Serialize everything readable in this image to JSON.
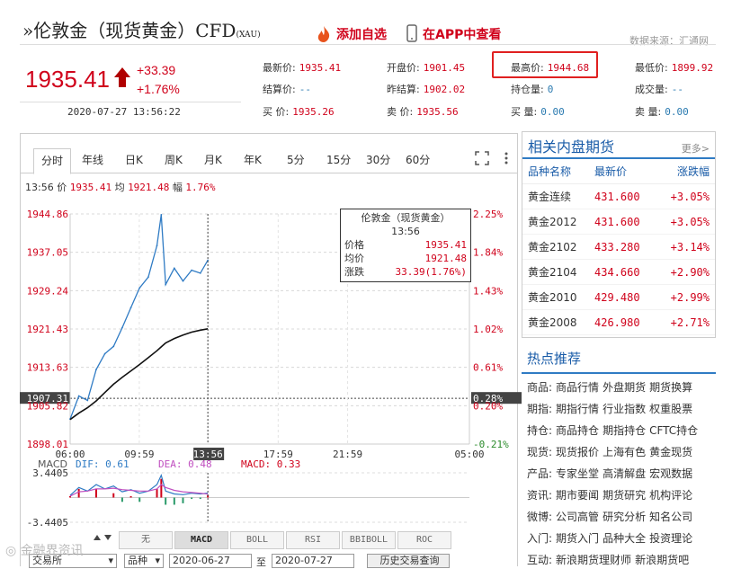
{
  "header": {
    "title": "»伦敦金（现货黄金）CFD",
    "title_sub": "(XAU)",
    "add_fav": "添加自选",
    "app_view": "在APP中查看",
    "source": "数据来源：汇通网"
  },
  "quote": {
    "price": "1935.41",
    "change": "+33.39",
    "change_pct": "+1.76%",
    "timestamp": "2020-07-27  13:56:22",
    "fields": [
      {
        "label": "最新价:",
        "value": "1935.41"
      },
      {
        "label": "开盘价:",
        "value": "1901.45"
      },
      {
        "label": "最高价:",
        "value": "1944.68"
      },
      {
        "label": "最低价:",
        "value": "1899.92"
      },
      {
        "label": "结算价:",
        "value": "--"
      },
      {
        "label": "昨结算:",
        "value": "1902.02"
      },
      {
        "label": "持仓量:",
        "value": "0"
      },
      {
        "label": "成交量:",
        "value": "--"
      },
      {
        "label": "买  价:",
        "value": "1935.26"
      },
      {
        "label": "卖  价:",
        "value": "1935.56"
      },
      {
        "label": "买  量:",
        "value": "0.00"
      },
      {
        "label": "卖  量:",
        "value": "0.00"
      }
    ]
  },
  "chart_tabs": [
    "分时",
    "年线",
    "日K",
    "周K",
    "月K",
    "年K",
    "5分",
    "15分",
    "30分",
    "60分"
  ],
  "chart_tools": {
    "fullscreen": "fullscreen-icon",
    "menu": "more-icon"
  },
  "info_line": {
    "time": "13:56",
    "price_label": "价",
    "price": "1935.41",
    "avg_label": "均",
    "avg": "1921.48",
    "amp_label": "幅",
    "amp": "1.76%"
  },
  "chart_data": {
    "type": "line",
    "y_ticks_left": [
      "1944.86",
      "1937.05",
      "1929.24",
      "1921.43",
      "1913.63",
      "1907.31",
      "1905.82",
      "1898.01"
    ],
    "y_ticks_right": [
      "2.25%",
      "1.84%",
      "1.43%",
      "1.02%",
      "0.61%",
      "0.28%",
      "0.20%",
      "-0.21%"
    ],
    "x_ticks": [
      "06:00",
      "09:59",
      "13:56",
      "17:59",
      "21:59",
      "05:00"
    ],
    "ylim": [
      1898.01,
      1944.86
    ],
    "x": [
      "06:00",
      "06:30",
      "07:00",
      "07:30",
      "08:00",
      "08:30",
      "09:00",
      "09:30",
      "10:00",
      "10:30",
      "11:00",
      "11:15",
      "11:30",
      "12:00",
      "12:30",
      "13:00",
      "13:30",
      "13:56"
    ],
    "series": [
      {
        "name": "价格",
        "values": [
          1903.1,
          1907.8,
          1906.9,
          1913.2,
          1916.4,
          1917.9,
          1921.7,
          1925.8,
          1929.8,
          1932.0,
          1938.4,
          1944.7,
          1930.5,
          1933.8,
          1931.2,
          1933.4,
          1932.8,
          1935.41
        ]
      },
      {
        "name": "均价",
        "values": [
          1903.0,
          1904.3,
          1905.4,
          1906.8,
          1908.5,
          1910.2,
          1911.6,
          1912.9,
          1914.2,
          1915.6,
          1917.0,
          1917.8,
          1918.6,
          1919.5,
          1920.2,
          1920.8,
          1921.2,
          1921.48
        ]
      }
    ],
    "tooltip": {
      "title": "伦敦金（现货黄金）",
      "time": "13:56",
      "rows": [
        {
          "label": "价格",
          "value": "1935.41"
        },
        {
          "label": "均价",
          "value": "1921.48"
        },
        {
          "label": "涨跌",
          "value": "33.39(1.76%)"
        }
      ]
    },
    "macd": {
      "dif_label": "DIF: 0.61",
      "dea_label": "DEA: 0.48",
      "macd_label": "MACD: 0.33",
      "name": "MACD",
      "y_ticks": [
        "3.4405",
        "-3.4405"
      ],
      "ylim": [
        -3.4405,
        3.4405
      ],
      "dif": [
        0.3,
        1.4,
        0.9,
        1.8,
        1.2,
        1.6,
        0.8,
        1.1,
        0.6,
        0.9,
        1.8,
        3.1,
        0.9,
        0.5,
        0.4,
        0.6,
        0.5,
        0.61
      ],
      "dea": [
        0.2,
        0.8,
        0.9,
        1.2,
        1.2,
        1.3,
        1.1,
        1.0,
        0.9,
        0.9,
        1.2,
        1.8,
        1.4,
        1.0,
        0.8,
        0.7,
        0.6,
        0.48
      ],
      "hist": [
        0.2,
        1.2,
        0.0,
        1.2,
        0.0,
        0.6,
        -0.6,
        0.2,
        -0.6,
        0.0,
        1.2,
        2.6,
        -1.0,
        -1.0,
        -0.8,
        -0.2,
        -0.2,
        0.33
      ]
    }
  },
  "indicator_tabs": [
    "无",
    "MACD",
    "BOLL",
    "RSI",
    "BBIBOLL",
    "ROC"
  ],
  "form": {
    "exchange": "交易所",
    "variety": "品种",
    "date_from": "2020-06-27",
    "to": "至",
    "date_to": "2020-07-27",
    "query_btn": "历史交易查询"
  },
  "related": {
    "title": "相关内盘期货",
    "more": "更多>",
    "columns": [
      "品种名称",
      "最新价",
      "涨跌幅"
    ],
    "rows": [
      {
        "name": "黄金连续",
        "price": "431.600",
        "pct": "+3.05%"
      },
      {
        "name": "黄金2012",
        "price": "431.600",
        "pct": "+3.05%"
      },
      {
        "name": "黄金2102",
        "price": "433.280",
        "pct": "+3.14%"
      },
      {
        "name": "黄金2104",
        "price": "434.660",
        "pct": "+2.90%"
      },
      {
        "name": "黄金2010",
        "price": "429.480",
        "pct": "+2.99%"
      },
      {
        "name": "黄金2008",
        "price": "426.980",
        "pct": "+2.71%"
      }
    ]
  },
  "hot": {
    "title": "热点推荐",
    "rows": [
      {
        "key": "商品:",
        "links": [
          "商品行情",
          "外盘期货",
          "期货换算"
        ]
      },
      {
        "key": "期指:",
        "links": [
          "期指行情",
          "行业指数",
          "权重股票"
        ]
      },
      {
        "key": "持仓:",
        "links": [
          "商品持仓",
          "期指持仓",
          "CFTC持仓"
        ]
      },
      {
        "key": "现货:",
        "links": [
          "现货报价",
          "上海有色",
          "黄金现货"
        ]
      },
      {
        "key": "产品:",
        "links": [
          "专家坐堂",
          "高清解盘",
          "宏观数据"
        ]
      },
      {
        "key": "资讯:",
        "links": [
          "期市要闻",
          "期货研究",
          "机构评论"
        ]
      },
      {
        "key": "微博:",
        "links": [
          "公司高管",
          "研究分析",
          "知名公司"
        ]
      },
      {
        "key": "入门:",
        "links": [
          "期货入门",
          "品种大全",
          "投资理论"
        ]
      },
      {
        "key": "互动:",
        "links": [
          "新浪期货理财师",
          "新浪期货吧"
        ]
      }
    ]
  },
  "watermark": "金融界资讯"
}
